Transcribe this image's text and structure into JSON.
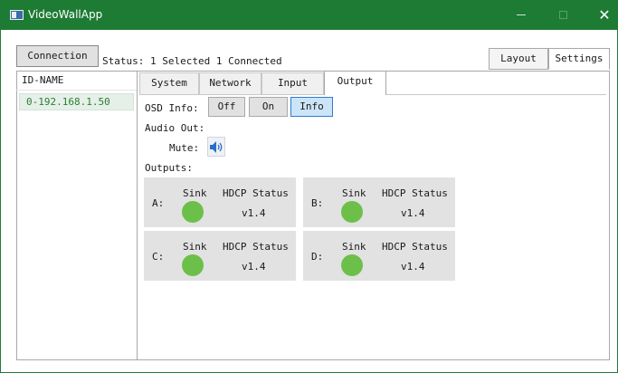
{
  "window": {
    "title": "VideoWallApp",
    "titlebar_color": "#1e7b34",
    "close_glyph": "✕"
  },
  "toolbar": {
    "connection_label": "Connection",
    "status_text": "Status: 1 Selected 1 Connected",
    "layout_label": "Layout",
    "settings_label": "Settings"
  },
  "device_list": {
    "header": "ID-NAME",
    "items": [
      {
        "label": "0-192.168.1.50",
        "selected": true
      }
    ]
  },
  "tabs": [
    {
      "label": "System",
      "active": false
    },
    {
      "label": "Network",
      "active": false
    },
    {
      "label": "Input",
      "active": false
    },
    {
      "label": "Output",
      "active": true
    }
  ],
  "output_tab": {
    "osd_info_label": "OSD Info:",
    "osd_options": [
      {
        "label": "Off",
        "selected": false
      },
      {
        "label": "On",
        "selected": false
      },
      {
        "label": "Info",
        "selected": true
      }
    ],
    "audio_out_label": "Audio Out:",
    "mute_label": "Mute:",
    "mute_icon": "speaker-icon",
    "outputs_label": "Outputs:",
    "outputs": [
      {
        "letter": "A:",
        "sink_label": "Sink",
        "hdcp_label": "HDCP Status",
        "hdcp_version": "v1.4",
        "sink_status_color": "#6cc04a"
      },
      {
        "letter": "B:",
        "sink_label": "Sink",
        "hdcp_label": "HDCP Status",
        "hdcp_version": "v1.4",
        "sink_status_color": "#6cc04a"
      },
      {
        "letter": "C:",
        "sink_label": "Sink",
        "hdcp_label": "HDCP Status",
        "hdcp_version": "v1.4",
        "sink_status_color": "#6cc04a"
      },
      {
        "letter": "D:",
        "sink_label": "Sink",
        "hdcp_label": "HDCP Status",
        "hdcp_version": "v1.4",
        "sink_status_color": "#6cc04a"
      }
    ]
  },
  "colors": {
    "selected_button": "#cce4f7",
    "selected_border": "#2f7bd1",
    "list_text": "#2e7d32"
  }
}
